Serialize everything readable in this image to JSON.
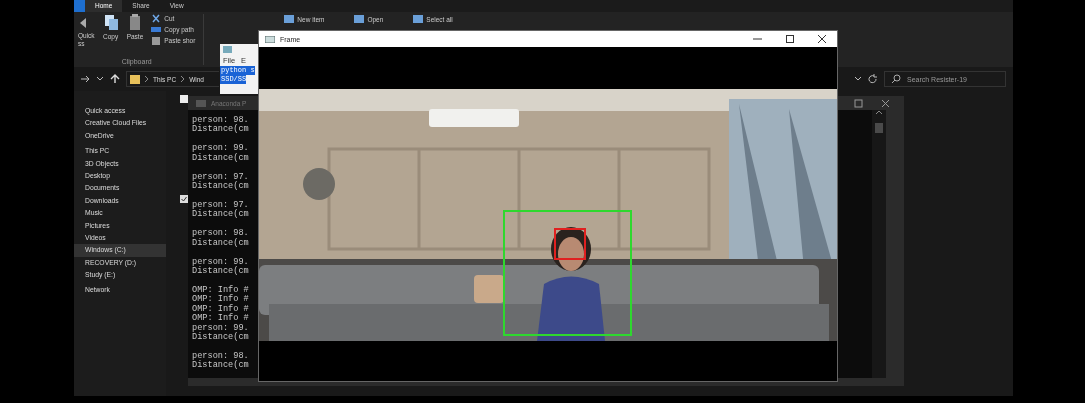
{
  "explorer": {
    "ribbon_tabs": [
      {
        "label": "Home",
        "selected": true
      },
      {
        "label": "Share",
        "selected": false
      },
      {
        "label": "View",
        "selected": false
      }
    ],
    "ribbon": {
      "pin_button": "Quick",
      "pin_button_rest": "ss",
      "large_buttons": [
        "Copy",
        "Paste"
      ],
      "small_buttons": [
        "Cut",
        "Copy path",
        "Paste shor"
      ],
      "group": "Clipboard",
      "right_buttons": [
        "New item",
        "Open",
        "Select all"
      ]
    },
    "address": [
      "This PC",
      "Wind"
    ],
    "search": {
      "placeholder": "Search Resister-19"
    },
    "nav_items": [
      {
        "label": "Quick access",
        "selected": false
      },
      {
        "label": "Creative Cloud Files",
        "selected": false
      },
      {
        "label": "OneDrive",
        "selected": false
      },
      {
        "label": "This PC",
        "selected": false
      },
      {
        "label": "3D Objects",
        "selected": false
      },
      {
        "label": "Desktop",
        "selected": false
      },
      {
        "label": "Documents",
        "selected": false
      },
      {
        "label": "Downloads",
        "selected": false
      },
      {
        "label": "Music",
        "selected": false
      },
      {
        "label": "Pictures",
        "selected": false
      },
      {
        "label": "Videos",
        "selected": false
      },
      {
        "label": "Windows (C:)",
        "selected": true
      },
      {
        "label": "RECOVERY (D:)",
        "selected": false
      },
      {
        "label": "Study (E:)",
        "selected": false
      },
      {
        "label": "Network",
        "selected": false
      }
    ],
    "item_checkboxes": [
      {
        "checked": false
      },
      {
        "checked": true
      }
    ]
  },
  "notepad": {
    "menu": [
      "File",
      "E"
    ],
    "selected_lines": [
      "python s",
      "SSD/SS"
    ]
  },
  "console": {
    "title": "Anaconda P",
    "blocks": [
      [
        "person: 98.",
        "Distance(cm"
      ],
      [
        "person: 99.",
        "Distance(cm"
      ],
      [
        "person: 97.",
        "Distance(cm"
      ],
      [
        "person: 97.",
        "Distance(cm"
      ],
      [
        "person: 98.",
        "Distance(cm"
      ],
      [
        "person: 99.",
        "Distance(cm"
      ],
      [
        "OMP: Info #",
        "OMP: Info #",
        "OMP: Info #",
        "OMP: Info #",
        "person: 99.",
        "Distance(cm"
      ],
      [
        "person: 98.",
        "Distance(cm"
      ]
    ]
  },
  "frame": {
    "title": "Frame"
  }
}
